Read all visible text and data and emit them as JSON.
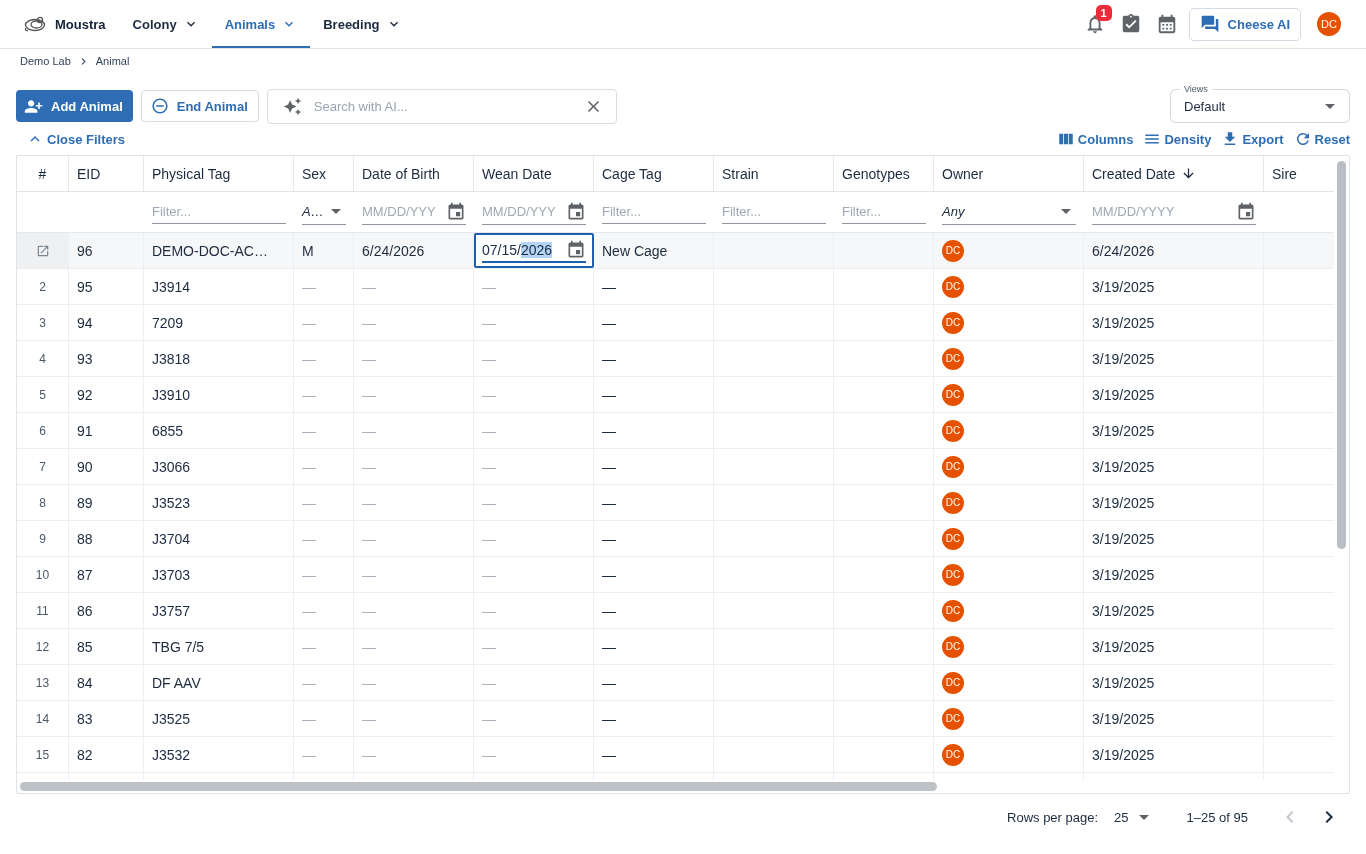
{
  "app": {
    "name": "Moustra"
  },
  "nav": [
    {
      "label": "Colony",
      "selected": false
    },
    {
      "label": "Animals",
      "selected": true
    },
    {
      "label": "Breeding",
      "selected": false
    }
  ],
  "header_actions": {
    "notification_count": "1",
    "assistant_button": "Cheese AI",
    "user_avatar": "DC"
  },
  "breadcrumb": [
    "Demo Lab",
    "Animal"
  ],
  "toolbar": {
    "add_button": "Add Animal",
    "end_button": "End Animal",
    "search": {
      "placeholder": "Search with AI..."
    },
    "views": {
      "label": "Views",
      "value": "Default"
    }
  },
  "filter_toggle": "Close Filters",
  "grid_actions": [
    {
      "kind": "columns",
      "label": "Columns"
    },
    {
      "kind": "density",
      "label": "Density"
    },
    {
      "kind": "export",
      "label": "Export"
    },
    {
      "kind": "reset",
      "label": "Reset"
    }
  ],
  "table": {
    "columns": [
      {
        "label": "#",
        "sorted": false
      },
      {
        "label": "EID",
        "sorted": false
      },
      {
        "label": "Physical Tag",
        "sorted": false,
        "filter": {
          "kind": "text",
          "placeholder": "Filter..."
        }
      },
      {
        "label": "Sex",
        "sorted": false,
        "filter": {
          "kind": "select",
          "value": "A…"
        }
      },
      {
        "label": "Date of Birth",
        "sorted": false,
        "filter": {
          "kind": "date",
          "placeholder": "MM/DD/YYY"
        }
      },
      {
        "label": "Wean Date",
        "sorted": false,
        "filter": {
          "kind": "date",
          "placeholder": "MM/DD/YYY"
        }
      },
      {
        "label": "Cage Tag",
        "sorted": false,
        "filter": {
          "kind": "text",
          "placeholder": "Filter..."
        }
      },
      {
        "label": "Strain",
        "sorted": false,
        "filter": {
          "kind": "text",
          "placeholder": "Filter..."
        }
      },
      {
        "label": "Genotypes",
        "sorted": false,
        "filter": {
          "kind": "text",
          "placeholder": "Filter..."
        }
      },
      {
        "label": "Owner",
        "sorted": false,
        "filter": {
          "kind": "select",
          "value": "Any"
        }
      },
      {
        "label": "Created Date",
        "sorted": true,
        "filter": {
          "kind": "date",
          "placeholder": "MM/DD/YYYY"
        }
      },
      {
        "label": "Sire",
        "sorted": false
      }
    ],
    "rows": [
      {
        "selected": true,
        "editing": true,
        "eid": "96",
        "physical_tag": "DEMO-DOC-AC…",
        "sex": {
          "text": "M",
          "muted": false
        },
        "date_of_birth": {
          "text": "6/24/2026",
          "muted": false
        },
        "wean_date": {
          "text": "07/15/2026",
          "muted": false
        },
        "cage_tag": "New Cage",
        "owner": "DC",
        "created_date": "6/24/2026"
      },
      {
        "number": "2",
        "selected": false,
        "editing": false,
        "eid": "95",
        "physical_tag": "J3914",
        "sex": {
          "text": "—",
          "muted": true
        },
        "date_of_birth": {
          "text": "—",
          "muted": true
        },
        "wean_date": {
          "text": "—",
          "muted": true
        },
        "cage_tag": "—",
        "owner": "DC",
        "created_date": "3/19/2025"
      },
      {
        "number": "3",
        "selected": false,
        "editing": false,
        "eid": "94",
        "physical_tag": "7209",
        "sex": {
          "text": "—",
          "muted": true
        },
        "date_of_birth": {
          "text": "—",
          "muted": true
        },
        "wean_date": {
          "text": "—",
          "muted": true
        },
        "cage_tag": "—",
        "owner": "DC",
        "created_date": "3/19/2025"
      },
      {
        "number": "4",
        "selected": false,
        "editing": false,
        "eid": "93",
        "physical_tag": "J3818",
        "sex": {
          "text": "—",
          "muted": true
        },
        "date_of_birth": {
          "text": "—",
          "muted": true
        },
        "wean_date": {
          "text": "—",
          "muted": true
        },
        "cage_tag": "—",
        "owner": "DC",
        "created_date": "3/19/2025"
      },
      {
        "number": "5",
        "selected": false,
        "editing": false,
        "eid": "92",
        "physical_tag": "J3910",
        "sex": {
          "text": "—",
          "muted": true
        },
        "date_of_birth": {
          "text": "—",
          "muted": true
        },
        "wean_date": {
          "text": "—",
          "muted": true
        },
        "cage_tag": "—",
        "owner": "DC",
        "created_date": "3/19/2025"
      },
      {
        "number": "6",
        "selected": false,
        "editing": false,
        "eid": "91",
        "physical_tag": "6855",
        "sex": {
          "text": "—",
          "muted": true
        },
        "date_of_birth": {
          "text": "—",
          "muted": true
        },
        "wean_date": {
          "text": "—",
          "muted": true
        },
        "cage_tag": "—",
        "owner": "DC",
        "created_date": "3/19/2025"
      },
      {
        "number": "7",
        "selected": false,
        "editing": false,
        "eid": "90",
        "physical_tag": "J3066",
        "sex": {
          "text": "—",
          "muted": true
        },
        "date_of_birth": {
          "text": "—",
          "muted": true
        },
        "wean_date": {
          "text": "—",
          "muted": true
        },
        "cage_tag": "—",
        "owner": "DC",
        "created_date": "3/19/2025"
      },
      {
        "number": "8",
        "selected": false,
        "editing": false,
        "eid": "89",
        "physical_tag": "J3523",
        "sex": {
          "text": "—",
          "muted": true
        },
        "date_of_birth": {
          "text": "—",
          "muted": true
        },
        "wean_date": {
          "text": "—",
          "muted": true
        },
        "cage_tag": "—",
        "owner": "DC",
        "created_date": "3/19/2025"
      },
      {
        "number": "9",
        "selected": false,
        "editing": false,
        "eid": "88",
        "physical_tag": "J3704",
        "sex": {
          "text": "—",
          "muted": true
        },
        "date_of_birth": {
          "text": "—",
          "muted": true
        },
        "wean_date": {
          "text": "—",
          "muted": true
        },
        "cage_tag": "—",
        "owner": "DC",
        "created_date": "3/19/2025"
      },
      {
        "number": "10",
        "selected": false,
        "editing": false,
        "eid": "87",
        "physical_tag": "J3703",
        "sex": {
          "text": "—",
          "muted": true
        },
        "date_of_birth": {
          "text": "—",
          "muted": true
        },
        "wean_date": {
          "text": "—",
          "muted": true
        },
        "cage_tag": "—",
        "owner": "DC",
        "created_date": "3/19/2025"
      },
      {
        "number": "11",
        "selected": false,
        "editing": false,
        "eid": "86",
        "physical_tag": "J3757",
        "sex": {
          "text": "—",
          "muted": true
        },
        "date_of_birth": {
          "text": "—",
          "muted": true
        },
        "wean_date": {
          "text": "—",
          "muted": true
        },
        "cage_tag": "—",
        "owner": "DC",
        "created_date": "3/19/2025"
      },
      {
        "number": "12",
        "selected": false,
        "editing": false,
        "eid": "85",
        "physical_tag": "TBG 7/5",
        "sex": {
          "text": "—",
          "muted": true
        },
        "date_of_birth": {
          "text": "—",
          "muted": true
        },
        "wean_date": {
          "text": "—",
          "muted": true
        },
        "cage_tag": "—",
        "owner": "DC",
        "created_date": "3/19/2025"
      },
      {
        "number": "13",
        "selected": false,
        "editing": false,
        "eid": "84",
        "physical_tag": "DF AAV",
        "sex": {
          "text": "—",
          "muted": true
        },
        "date_of_birth": {
          "text": "—",
          "muted": true
        },
        "wean_date": {
          "text": "—",
          "muted": true
        },
        "cage_tag": "—",
        "owner": "DC",
        "created_date": "3/19/2025"
      },
      {
        "number": "14",
        "selected": false,
        "editing": false,
        "eid": "83",
        "physical_tag": "J3525",
        "sex": {
          "text": "—",
          "muted": true
        },
        "date_of_birth": {
          "text": "—",
          "muted": true
        },
        "wean_date": {
          "text": "—",
          "muted": true
        },
        "cage_tag": "—",
        "owner": "DC",
        "created_date": "3/19/2025"
      },
      {
        "number": "15",
        "selected": false,
        "editing": false,
        "eid": "82",
        "physical_tag": "J3532",
        "sex": {
          "text": "—",
          "muted": true
        },
        "date_of_birth": {
          "text": "—",
          "muted": true
        },
        "wean_date": {
          "text": "—",
          "muted": true
        },
        "cage_tag": "—",
        "owner": "DC",
        "created_date": "3/19/2025"
      }
    ]
  },
  "pagination": {
    "rows_per_page_label": "Rows per page:",
    "rows_per_page": "25",
    "range": "1–25 of 95",
    "previous_disabled": true,
    "next_disabled": false
  }
}
